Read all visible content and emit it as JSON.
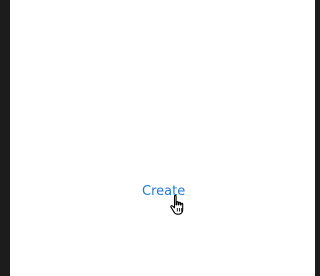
{
  "main": {
    "create_label": "Create"
  },
  "cursor": {
    "icon": "hand-pointer-icon"
  },
  "colors": {
    "link": "#1f7ad8",
    "background": "#ffffff",
    "frame": "#1c1c1c"
  }
}
